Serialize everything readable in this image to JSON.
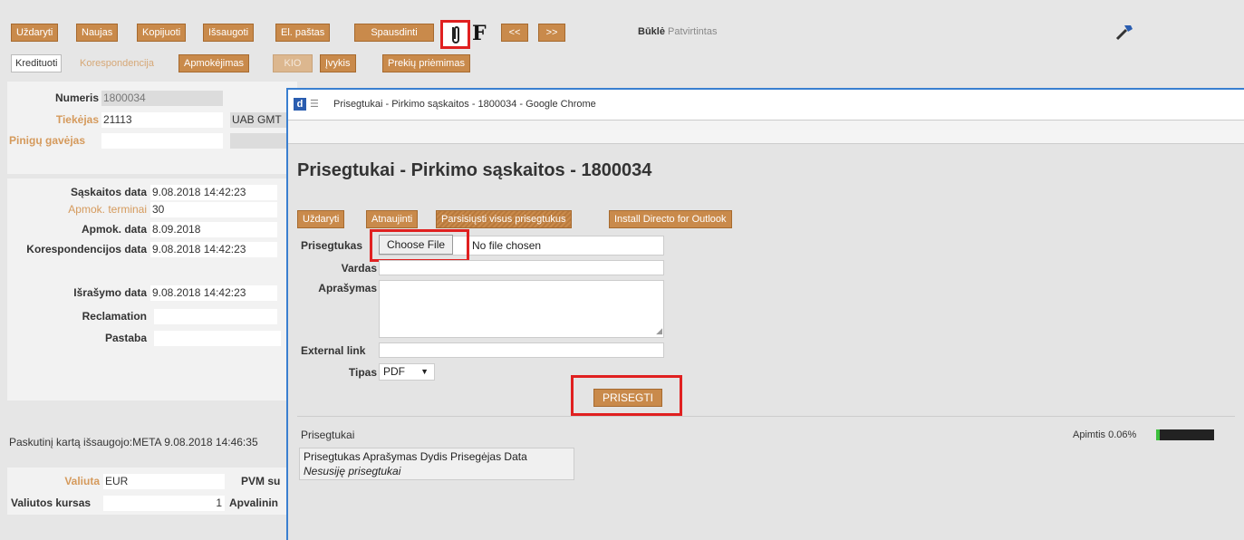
{
  "toolbar": {
    "row1": [
      "Uždaryti",
      "Naujas",
      "Kopijuoti",
      "Išsaugoti",
      "El. paštas",
      "Spausdinti"
    ],
    "f_label": "F",
    "prev_label": "<<",
    "next_label": ">>",
    "status_label": "Būklė",
    "status_value": "Patvirtintas",
    "row2": {
      "kredituoti": "Kredituoti",
      "korespondencija": "Korespondencija",
      "apmokejimas": "Apmokėjimas",
      "kio": "KIO",
      "ivykis": "Įvykis",
      "prekiu_priemimas": "Prekių priėmimas"
    }
  },
  "header_form": {
    "numeris_label": "Numeris",
    "numeris_value": "1800034",
    "tiekejas_label": "Tiekėjas",
    "tiekejas_value": "21113",
    "tiekejas_name": "UAB GMT",
    "pinigu_gavejas_label": "Pinigų gavėjas"
  },
  "dates_form": {
    "saskaitos_data_label": "Sąskaitos data",
    "saskaitos_data_value": "9.08.2018 14:42:23",
    "apmok_terminai_label": "Apmok. terminai",
    "apmok_terminai_value": "30",
    "apmok_data_label": "Apmok. data",
    "apmok_data_value": "8.09.2018",
    "koresp_data_label": "Korespondencijos data",
    "koresp_data_value": "9.08.2018 14:42:23",
    "israsymo_data_label": "Išrašymo data",
    "israsymo_data_value": "9.08.2018 14:42:23",
    "reclamation_label": "Reclamation",
    "pastaba_label": "Pastaba"
  },
  "last_saved": "Paskutinį kartą išsaugojo:META 9.08.2018 14:46:35",
  "currency_form": {
    "valiuta_label": "Valiuta",
    "valiuta_value": "EUR",
    "pvm_label": "PVM su",
    "kursas_label": "Valiutos kursas",
    "kursas_value": "1",
    "apvalinimas_label": "Apvalinin"
  },
  "popup": {
    "window_title": "Prisegtukai - Pirkimo sąskaitos - 1800034 - Google Chrome",
    "heading": "Prisegtukai - Pirkimo sąskaitos - 1800034",
    "buttons": {
      "close": "Uždaryti",
      "refresh": "Atnaujinti",
      "download_all": "Parsisiųsti visus prisegtukus",
      "install": "Install Directo for Outlook"
    },
    "form": {
      "file_label": "Prisegtukas",
      "choose_file": "Choose File",
      "no_file": "No file chosen",
      "name_label": "Vardas",
      "desc_label": "Aprašymas",
      "external_label": "External link",
      "type_label": "Tipas",
      "type_value": "PDF",
      "attach_button": "PRISEGTI"
    },
    "attachments": {
      "title": "Prisegtukai",
      "usage": "Apimtis 0.06%",
      "usage_fraction": 0.0006,
      "columns": "Prisegtukas Aprašymas Dydis Prisegėjas Data",
      "empty": "Nesusiję prisegtukai"
    }
  },
  "colors": {
    "button_orange": "#c98a4b",
    "highlight_red": "#e02020",
    "popup_border": "#3a7fd0"
  }
}
